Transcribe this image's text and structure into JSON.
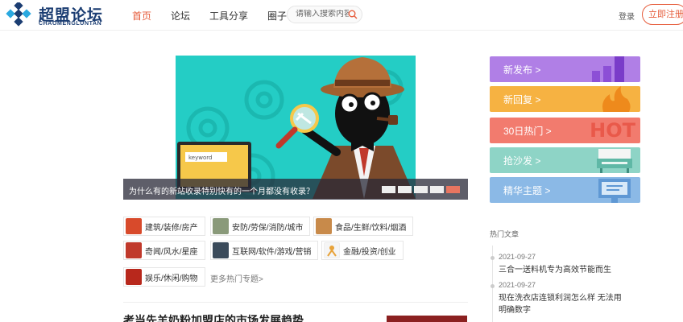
{
  "logo": {
    "cn": "超盟论坛",
    "en": "CHAOMENGLUNTAN"
  },
  "nav": [
    {
      "label": "首页"
    },
    {
      "label": "论坛"
    },
    {
      "label": "工具分享"
    },
    {
      "label": "圈子"
    }
  ],
  "search": {
    "placeholder": "请输入搜索内容"
  },
  "auth": {
    "login": "登录",
    "register": "立即注册"
  },
  "banner": {
    "caption": "为什么有的新站收录特别快有的一个月都没有收录？",
    "screen_text": "keyword",
    "slides": 5,
    "active_slide": 5
  },
  "categories": [
    {
      "label": "建筑/装修/房产",
      "color": "#d84a2b"
    },
    {
      "label": "安防/劳保/消防/城市",
      "color": "#8a9a7a"
    },
    {
      "label": "食品/生鲜/饮料/烟酒",
      "color": "#c88a4a"
    },
    {
      "label": "奇闻/风水/星座",
      "color": "#c0392b"
    },
    {
      "label": "互联网/软件/游戏/营销",
      "color": "#3a4a5a"
    },
    {
      "label": "金融/投资/创业",
      "color": "#e8a33a"
    },
    {
      "label": "娱乐/休闲/购物",
      "color": "#b8281c"
    }
  ],
  "more_topics": "更多热门专题>",
  "article": {
    "title": "考当先羊奶粉加盟店的市场发展趋势"
  },
  "side_buttons": [
    {
      "label": "新发布 >",
      "color": "#b07fe6",
      "deco": "bars"
    },
    {
      "label": "新回复 >",
      "color": "#f6b242",
      "deco": "flame"
    },
    {
      "label": "30日热门 >",
      "color": "#f27b6e",
      "deco": "HOT"
    },
    {
      "label": "抢沙发 >",
      "color": "#8ed4c6",
      "deco": "sofa"
    },
    {
      "label": "精华主题 >",
      "color": "#8bb9e6",
      "deco": "screen"
    }
  ],
  "hot": {
    "heading": "热门文章",
    "items": [
      {
        "date": "2021-09-27",
        "title": "三合一送料机专为高效节能而生"
      },
      {
        "date": "2021-09-27",
        "title": "现在洗衣店连锁利润怎么样 无法用明确数字"
      }
    ]
  }
}
